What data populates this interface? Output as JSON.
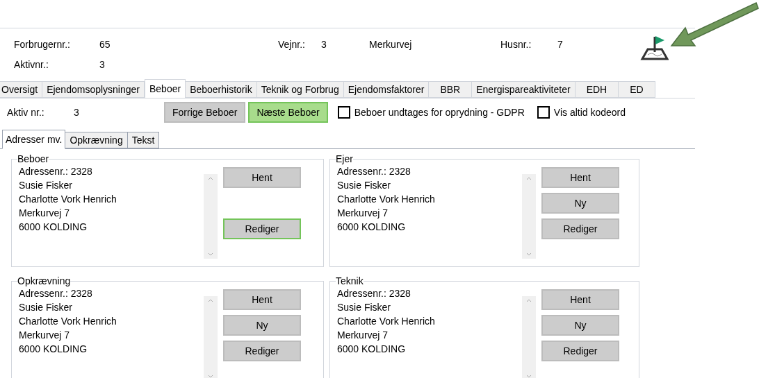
{
  "header": {
    "fields": [
      {
        "label": "Forbrugernr.:",
        "value": "65"
      },
      {
        "label": "Vejnr.:",
        "value": "3"
      },
      {
        "label": "Husnr.:",
        "value": "7"
      },
      {
        "label": "Aktivnr.:",
        "value": "3"
      }
    ],
    "street": "Merkurvej"
  },
  "tabs": [
    {
      "label": "Oversigt",
      "selected": false
    },
    {
      "label": "Ejendomsoplysninger",
      "selected": false
    },
    {
      "label": "Beboer",
      "selected": true
    },
    {
      "label": "Beboerhistorik",
      "selected": false
    },
    {
      "label": "Teknik og Forbrug",
      "selected": false
    },
    {
      "label": "Ejendomsfaktorer",
      "selected": false
    },
    {
      "label": "BBR",
      "selected": false
    },
    {
      "label": "Energispareaktiviteter",
      "selected": false
    },
    {
      "label": "EDH",
      "selected": false
    },
    {
      "label": "ED",
      "selected": false
    }
  ],
  "toolbar": {
    "label": "Aktiv nr.:",
    "value": "3",
    "buttons": [
      {
        "label": "Forrige Beboer",
        "highlighted": false
      },
      {
        "label": "Næste Beboer",
        "highlighted": true
      }
    ],
    "checkboxes": [
      {
        "label": "Beboer undtages for oprydning - GDPR",
        "checked": false
      },
      {
        "label": "Vis altid kodeord",
        "checked": false
      }
    ]
  },
  "subtabs": [
    {
      "label": "Adresser mv.",
      "selected": true
    },
    {
      "label": "Opkrævning",
      "selected": false
    },
    {
      "label": "Tekst",
      "selected": false
    }
  ],
  "groups": [
    {
      "title": "Beboer",
      "lines": [
        "Adressenr.: 2328",
        "Susie Fisker",
        "Charlotte Vork Henrich",
        "Merkurvej 7",
        "6000 KOLDING"
      ],
      "buttons": [
        {
          "label": "Hent",
          "focused": false
        },
        {
          "label": "Rediger",
          "focused": true
        }
      ]
    },
    {
      "title": "Ejer",
      "lines": [
        "Adressenr.: 2328",
        "Susie Fisker",
        "Charlotte Vork Henrich",
        "Merkurvej 7",
        "6000 KOLDING"
      ],
      "buttons": [
        {
          "label": "Hent",
          "focused": false
        },
        {
          "label": "Ny",
          "focused": false
        },
        {
          "label": "Rediger",
          "focused": false
        }
      ]
    },
    {
      "title": "Opkrævning",
      "lines": [
        "Adressenr.: 2328",
        "Susie Fisker",
        "Charlotte Vork Henrich",
        "Merkurvej 7",
        "6000 KOLDING"
      ],
      "buttons": [
        {
          "label": "Hent",
          "focused": false
        },
        {
          "label": "Ny",
          "focused": false
        },
        {
          "label": "Rediger",
          "focused": false
        }
      ]
    },
    {
      "title": "Teknik",
      "lines": [
        "Adressenr.: 2328",
        "Susie Fisker",
        "Charlotte Vork Henrich",
        "Merkurvej 7",
        "6000 KOLDING"
      ],
      "buttons": [
        {
          "label": "Hent",
          "focused": false
        },
        {
          "label": "Ny",
          "focused": false
        },
        {
          "label": "Rediger",
          "focused": false
        }
      ]
    }
  ]
}
